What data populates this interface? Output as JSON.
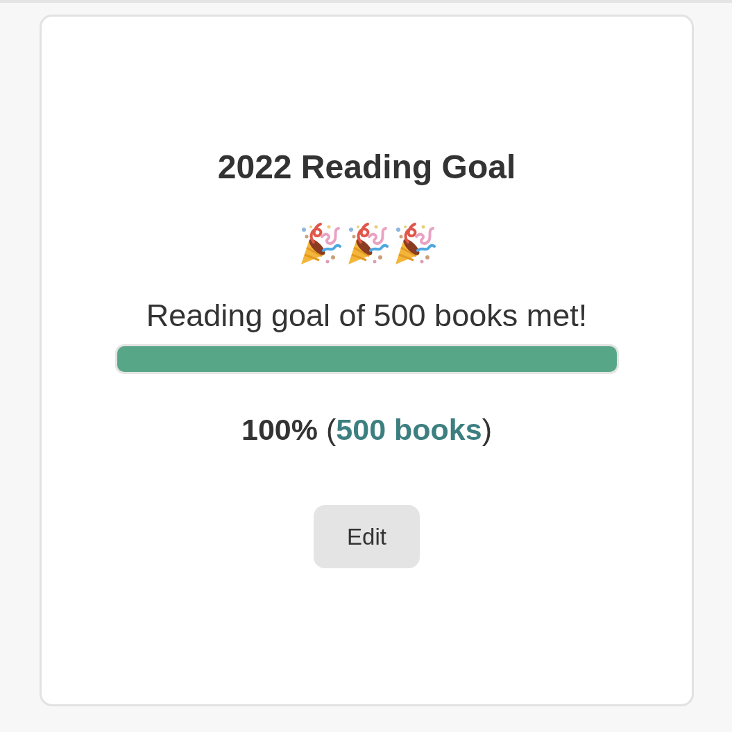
{
  "card": {
    "title": "2022 Reading Goal",
    "message": "Reading goal of 500 books met!",
    "progress": {
      "level": 1
    },
    "summary": {
      "before": "**100%** (",
      "link": "500 books",
      "after": ")"
    },
    "button": "Edit"
  }
}
